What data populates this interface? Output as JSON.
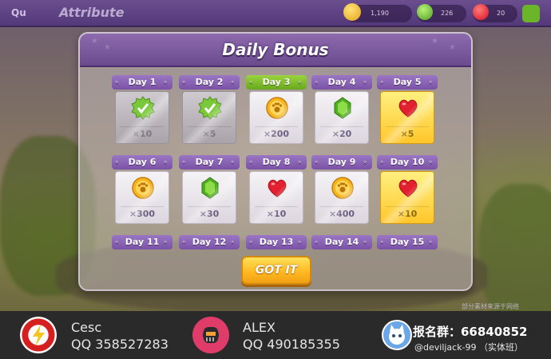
{
  "top_bar": {
    "back_label": "Qu",
    "title": "Attribute",
    "coins": "1,190",
    "gems": "226",
    "hearts": "20"
  },
  "dialog": {
    "title": "Daily Bonus",
    "got_it_label": "GOT IT"
  },
  "days": [
    {
      "label": "Day 1",
      "amount": "×10",
      "reward": "claimed"
    },
    {
      "label": "Day 2",
      "amount": "×5",
      "reward": "claimed"
    },
    {
      "label": "Day 3",
      "amount": "×200",
      "reward": "coin",
      "current": true
    },
    {
      "label": "Day 4",
      "amount": "×20",
      "reward": "gem"
    },
    {
      "label": "Day 5",
      "amount": "×5",
      "reward": "heart",
      "special": true
    },
    {
      "label": "Day 6",
      "amount": "×300",
      "reward": "coin"
    },
    {
      "label": "Day 7",
      "amount": "×30",
      "reward": "gem"
    },
    {
      "label": "Day 8",
      "amount": "×10",
      "reward": "heart"
    },
    {
      "label": "Day 9",
      "amount": "×400",
      "reward": "coin"
    },
    {
      "label": "Day 10",
      "amount": "×10",
      "reward": "heart",
      "special": true
    }
  ],
  "partial_days": [
    "Day 11",
    "Day 12",
    "Day 13",
    "Day 14",
    "Day 15"
  ],
  "watermark": "部分素材来源于网络",
  "footer": {
    "person1": {
      "name": "Cesc",
      "qq": "QQ 358527283"
    },
    "person2": {
      "name": "ALEX",
      "qq": "QQ 490185355"
    },
    "group_title": "报名群：66840852",
    "group_handle": "@deviljack-99 （实体班）"
  },
  "colors": {
    "header_purple": "#7a52a6",
    "current_green": "#7cbf2a",
    "gold": "#ffc62a"
  }
}
